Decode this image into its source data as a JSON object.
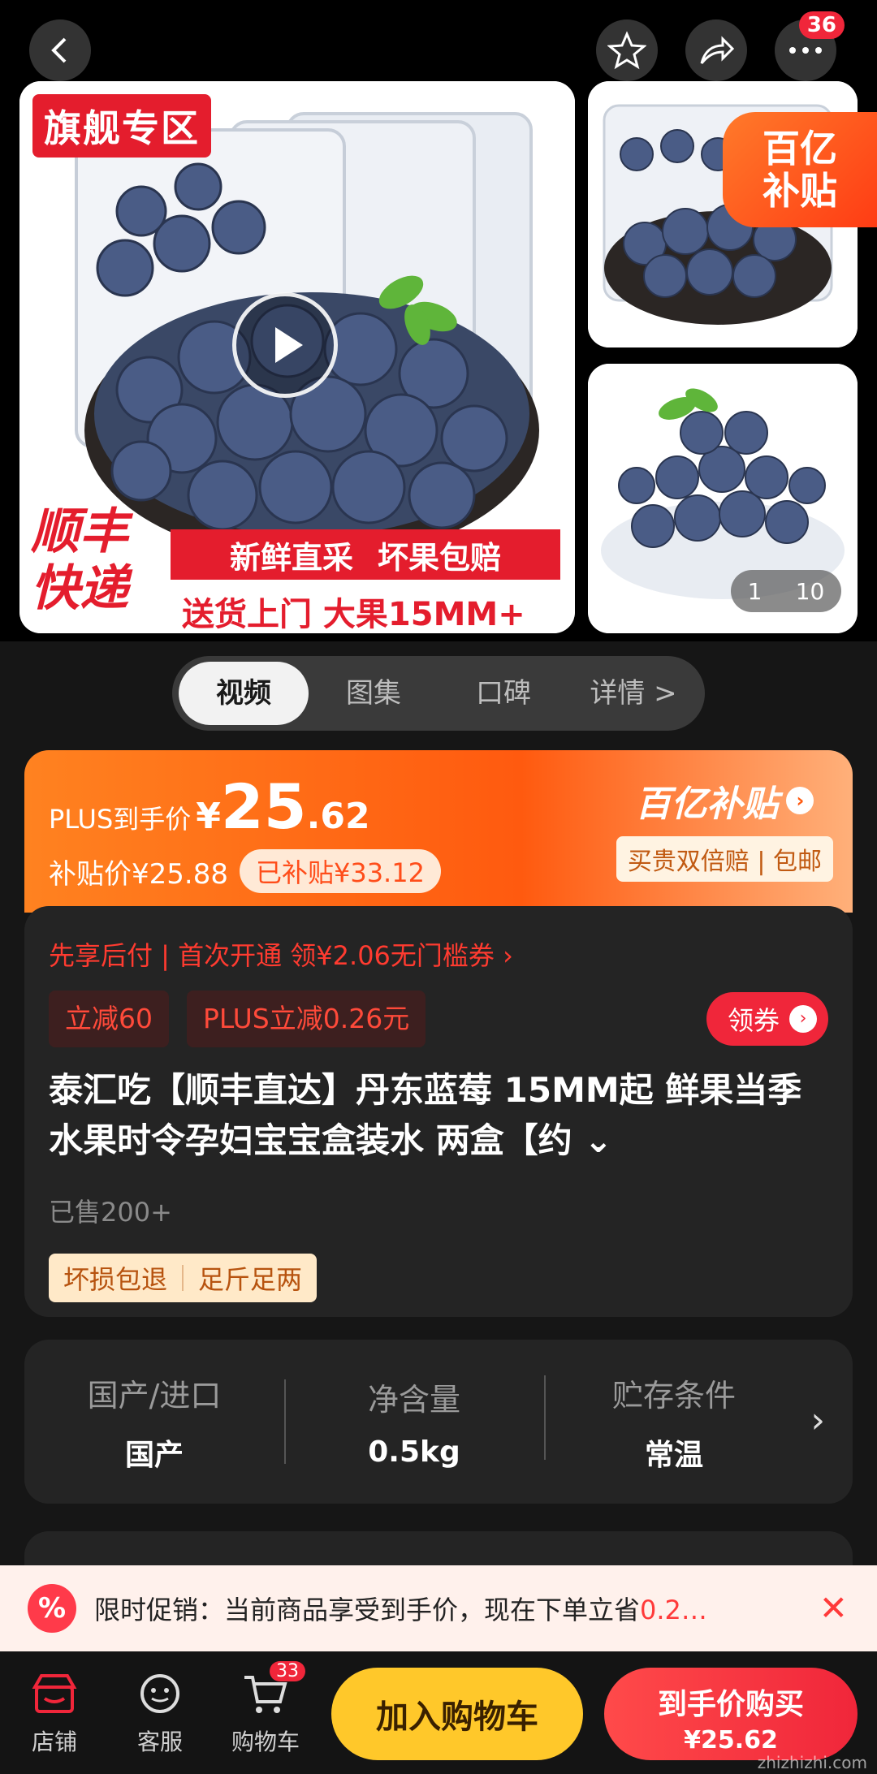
{
  "header": {
    "back_icon": "chevron-left-icon",
    "favorite_icon": "star-icon",
    "share_icon": "share-icon",
    "more_icon": "more-dots-icon",
    "more_badge": "36"
  },
  "gallery": {
    "main_image": {
      "flag_tag": "旗舰专区",
      "shipping_text": "顺丰快递",
      "strip_left": "新鲜直采",
      "strip_right": "坏果包赔",
      "delivery_text": "送货上门 大果15MM+"
    },
    "subsidy_corner_line1": "百亿",
    "subsidy_corner_line2": "补贴",
    "pager_current": "1",
    "pager_total": "10"
  },
  "tabs": [
    {
      "label": "视频",
      "active": true
    },
    {
      "label": "图集",
      "active": false
    },
    {
      "label": "口碑",
      "active": false
    },
    {
      "label": "详情 >",
      "active": false
    }
  ],
  "price": {
    "plus_label": "PLUS到手价",
    "currency": "¥",
    "integer": "25",
    "decimal": ".62",
    "subsidy_price": "补贴价¥25.88",
    "subsidized": "已补贴¥33.12",
    "brand_title": "百亿补贴",
    "brand_tags": "买贵双倍赔 | 包邮"
  },
  "info": {
    "pay_later": "先享后付 | 首次开通 领¥2.06无门槛券 ›",
    "chips": [
      "立减60",
      "PLUS立减0.26元"
    ],
    "get_coupon": "领券",
    "title": "泰汇吃【顺丰直达】丹东蓝莓 15MM起 鲜果当季水果时令孕妇宝宝盒装水 两盒【约 ⌄",
    "sold": "已售200+",
    "guarantees": [
      "坏损包退",
      "足斤足两"
    ]
  },
  "specs": [
    {
      "key": "国产/进口",
      "value": "国产"
    },
    {
      "key": "净含量",
      "value": "0.5kg"
    },
    {
      "key": "贮存条件",
      "value": "常温"
    }
  ],
  "promo": {
    "text": "限时促销：当前商品享受到手价，现在下单立省",
    "highlight": "0.2…"
  },
  "bottom": {
    "store": "店铺",
    "service": "客服",
    "cart": "购物车",
    "cart_badge": "33",
    "add_cart": "加入购物车",
    "buy_line1": "到手价购买",
    "buy_line2": "¥25.62",
    "watermark": "zhizhizhi.com"
  },
  "colors": {
    "accent_red": "#f0263a",
    "orange": "#ff5a0f",
    "yellow_button": "#ffc82a",
    "background": "#161616"
  }
}
